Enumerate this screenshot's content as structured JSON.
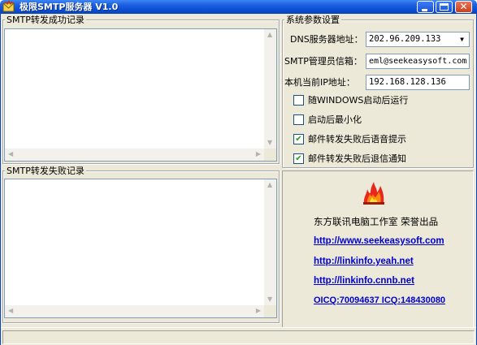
{
  "window": {
    "title": "极限SMTP服务器 V1.0",
    "icon": "app-icon"
  },
  "success_log": {
    "label": "SMTP转发成功记录",
    "items": []
  },
  "failure_log": {
    "label": "SMTP转发失败记录",
    "items": []
  },
  "settings": {
    "label": "系统参数设置",
    "dns_label": "DNS服务器地址：",
    "dns_value": "202.96.209.133",
    "admin_email_label": "SMTP管理员信箱：",
    "admin_email_value": "eml@seekeasysoft.com",
    "local_ip_label": "本机当前IP地址：",
    "local_ip_value": "192.168.128.136",
    "options": [
      {
        "label": "随WINDOWS启动后运行",
        "checked": false
      },
      {
        "label": "启动后最小化",
        "checked": false
      },
      {
        "label": "邮件转发失败后语音提示",
        "checked": true
      },
      {
        "label": "邮件转发失败后退信通知",
        "checked": true
      }
    ]
  },
  "about": {
    "logo": "fire-logo",
    "credit": "东方联讯电脑工作室 荣誉出品",
    "links": [
      "http://www.seekeasysoft.com",
      "http://linkinfo.yeah.net",
      "http://linkinfo.cnnb.net",
      "OICQ:70094637 ICQ:148430080"
    ]
  },
  "colors": {
    "titlebar": "#0a4fd6",
    "face": "#ece9d8",
    "link": "#0000cc",
    "check": "#21a121"
  }
}
